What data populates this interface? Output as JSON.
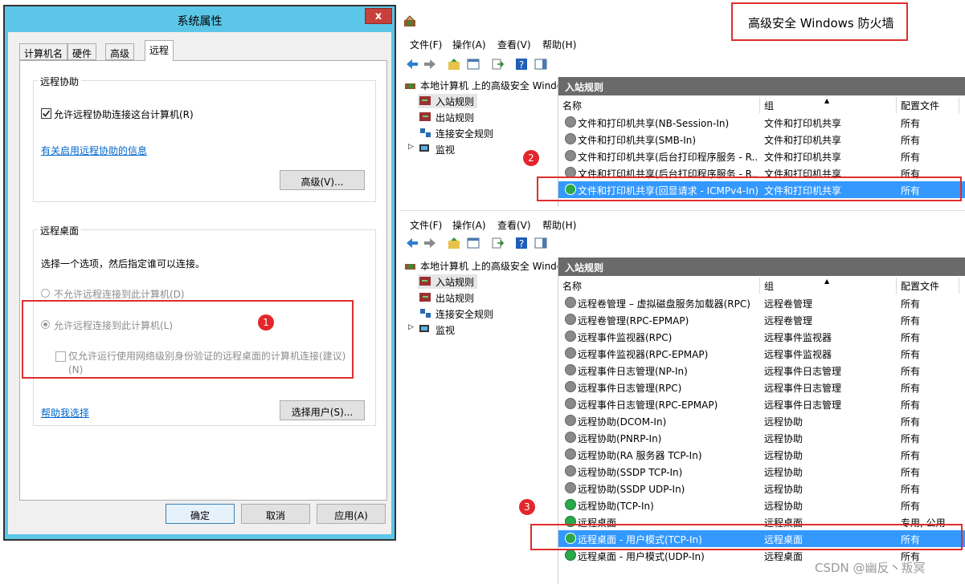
{
  "dialog": {
    "title": "系统属性",
    "close_glyph": "x",
    "tabs": [
      "计算机名",
      "硬件",
      "高级",
      "远程"
    ],
    "assist": {
      "group_label": "远程协助",
      "checkbox_label": "允许远程协助连接这台计算机(R)",
      "info_link": "有关启用远程协助的信息",
      "advanced_btn": "高级(V)..."
    },
    "desktop": {
      "group_label": "远程桌面",
      "prompt": "选择一个选项，然后指定谁可以连接。",
      "opt_deny": "不允许远程连接到此计算机(D)",
      "opt_allow": "允许远程连接到此计算机(L)",
      "nla_line1": "仅允许运行使用网络级别身份验证的远程桌面的计算机连接(建议)",
      "nla_line2": "(N)",
      "help_link": "帮助我选择",
      "select_users_btn": "选择用户(S)..."
    },
    "ok": "确定",
    "cancel": "取消",
    "apply": "应用(A)"
  },
  "firewall_title": "高级安全 Windows 防火墙",
  "badges": [
    "1",
    "2",
    "3"
  ],
  "menu": [
    "文件(F)",
    "操作(A)",
    "查看(V)",
    "帮助(H)"
  ],
  "tree": {
    "root": "本地计算机 上的高级安全 Windows",
    "inbound": "入站规则",
    "outbound": "出站规则",
    "connsec": "连接安全规则",
    "monitor": "监视"
  },
  "panel_title": "入站规则",
  "columns": {
    "name": "名称",
    "group": "组",
    "profile": "配置文件"
  },
  "top_rows": [
    {
      "name": "文件和打印机共享(NB-Session-In)",
      "group": "文件和打印机共享",
      "profile": "所有",
      "state": "dis"
    },
    {
      "name": "文件和打印机共享(SMB-In)",
      "group": "文件和打印机共享",
      "profile": "所有",
      "state": "dis"
    },
    {
      "name": "文件和打印机共享(后台打印程序服务 - R...",
      "group": "文件和打印机共享",
      "profile": "所有",
      "state": "dis"
    },
    {
      "name": "文件和打印机共享(后台打印程序服务 - R...",
      "group": "文件和打印机共享",
      "profile": "所有",
      "state": "dis"
    },
    {
      "name": "文件和打印机共享(回显请求 - ICMPv4-In)",
      "group": "文件和打印机共享",
      "profile": "所有",
      "state": "sel"
    }
  ],
  "bottom_rows": [
    {
      "name": "远程卷管理 – 虚拟磁盘服务加载器(RPC)",
      "group": "远程卷管理",
      "profile": "所有",
      "state": "dis"
    },
    {
      "name": "远程卷管理(RPC-EPMAP)",
      "group": "远程卷管理",
      "profile": "所有",
      "state": "dis"
    },
    {
      "name": "远程事件监视器(RPC)",
      "group": "远程事件监视器",
      "profile": "所有",
      "state": "dis"
    },
    {
      "name": "远程事件监视器(RPC-EPMAP)",
      "group": "远程事件监视器",
      "profile": "所有",
      "state": "dis"
    },
    {
      "name": "远程事件日志管理(NP-In)",
      "group": "远程事件日志管理",
      "profile": "所有",
      "state": "dis"
    },
    {
      "name": "远程事件日志管理(RPC)",
      "group": "远程事件日志管理",
      "profile": "所有",
      "state": "dis"
    },
    {
      "name": "远程事件日志管理(RPC-EPMAP)",
      "group": "远程事件日志管理",
      "profile": "所有",
      "state": "dis"
    },
    {
      "name": "远程协助(DCOM-In)",
      "group": "远程协助",
      "profile": "所有",
      "state": "dis"
    },
    {
      "name": "远程协助(PNRP-In)",
      "group": "远程协助",
      "profile": "所有",
      "state": "dis"
    },
    {
      "name": "远程协助(RA 服务器 TCP-In)",
      "group": "远程协助",
      "profile": "所有",
      "state": "dis"
    },
    {
      "name": "远程协助(SSDP TCP-In)",
      "group": "远程协助",
      "profile": "所有",
      "state": "dis"
    },
    {
      "name": "远程协助(SSDP UDP-In)",
      "group": "远程协助",
      "profile": "所有",
      "state": "dis"
    },
    {
      "name": "远程协助(TCP-In)",
      "group": "远程协助",
      "profile": "所有",
      "state": "en"
    },
    {
      "name": "远程桌面",
      "group": "远程桌面",
      "profile": "专用, 公用",
      "state": "en"
    },
    {
      "name": "远程桌面 - 用户模式(TCP-In)",
      "group": "远程桌面",
      "profile": "所有",
      "state": "sel"
    },
    {
      "name": "远程桌面 - 用户模式(UDP-In)",
      "group": "远程桌面",
      "profile": "所有",
      "state": "en"
    }
  ],
  "watermark": "CSDN @幽反丶叛冥",
  "colors": {
    "titlebar": "#5cc6e8",
    "selection": "#3399ff",
    "highlight_box": "#e02d2d",
    "panel_header": "#6a6a6a"
  }
}
